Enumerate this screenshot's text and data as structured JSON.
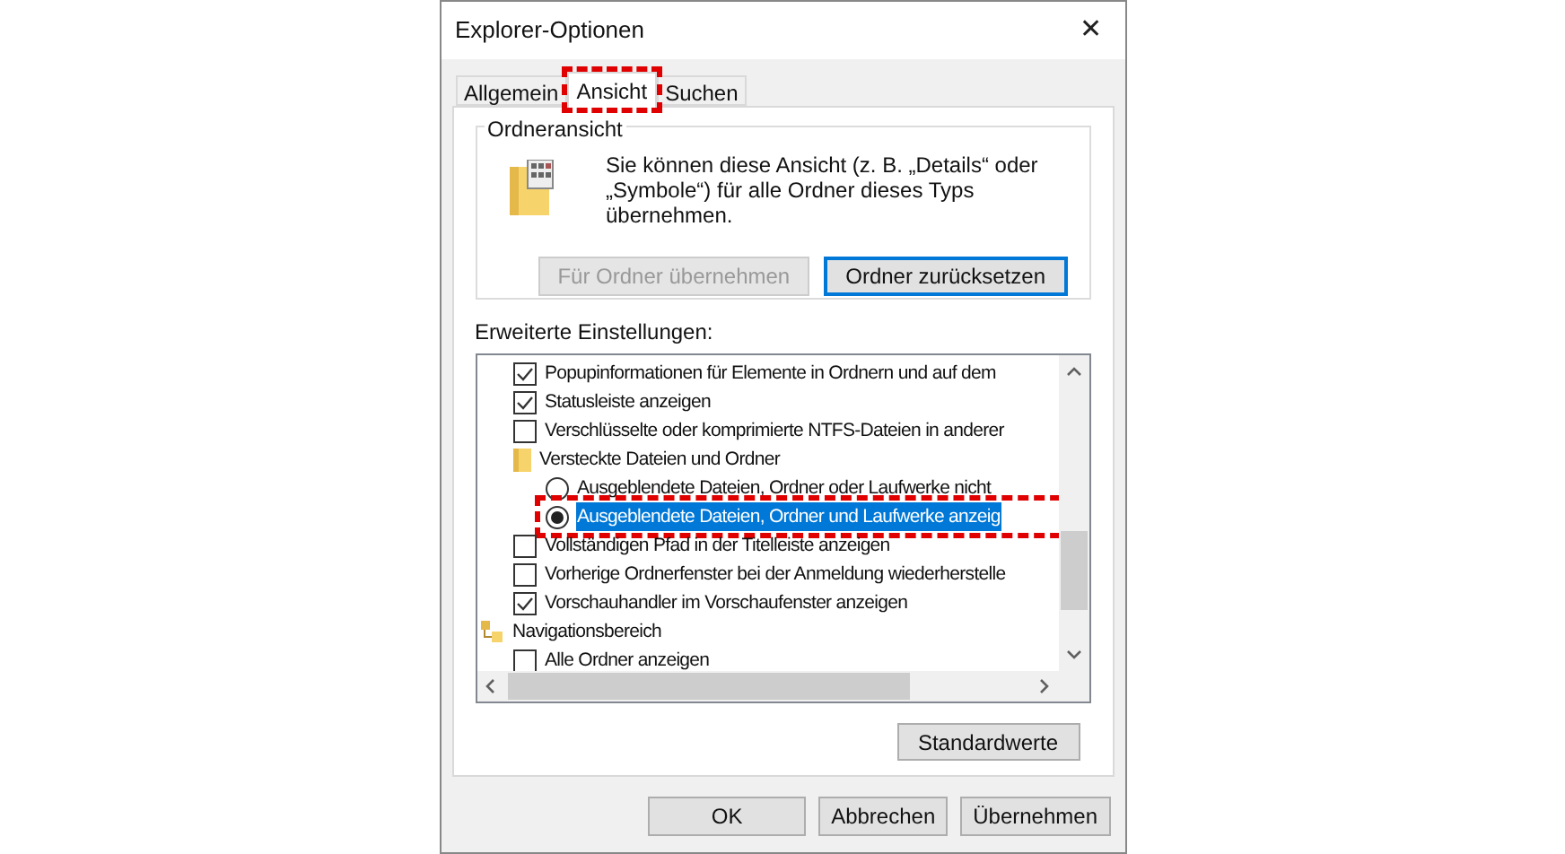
{
  "window": {
    "title": "Explorer-Optionen",
    "close": "✕"
  },
  "tabs": [
    {
      "label": "Allgemein",
      "selected": false,
      "highlight": false
    },
    {
      "label": "Ansicht",
      "selected": true,
      "highlight": true
    },
    {
      "label": "Suchen",
      "selected": false,
      "highlight": false
    }
  ],
  "folder_view": {
    "title": "Ordneransicht",
    "text": "Sie können diese Ansicht (z. B. „Details“ oder „Symbole“) für alle Ordner dieses Typs übernehmen.",
    "buttons": [
      {
        "label": "Für Ordner übernehmen",
        "disabled": true,
        "focused": false
      },
      {
        "label": "Ordner zurücksetzen",
        "disabled": false,
        "focused": true
      }
    ]
  },
  "advanced": {
    "label": "Erweiterte Einstellungen:",
    "items": [
      {
        "kind": "hidden-parent",
        "children": [
          {
            "kind": "checkbox",
            "label": "Popupinformationen für Elemente in Ordnern und auf dem",
            "checked": true,
            "selected": false,
            "highlight": false
          },
          {
            "kind": "checkbox",
            "label": "Statusleiste anzeigen",
            "checked": true,
            "selected": false,
            "highlight": false
          },
          {
            "kind": "checkbox",
            "label": "Verschlüsselte oder komprimierte NTFS-Dateien in anderer",
            "checked": false,
            "selected": false,
            "highlight": false
          },
          {
            "kind": "folder",
            "label": "Versteckte Dateien und Ordner",
            "children": [
              {
                "kind": "radio",
                "label": "Ausgeblendete Dateien, Ordner oder Laufwerke nicht",
                "checked": false,
                "selected": false,
                "highlight": false
              },
              {
                "kind": "radio",
                "label": "Ausgeblendete Dateien, Ordner und Laufwerke anzeig",
                "checked": true,
                "selected": true,
                "highlight": true
              }
            ]
          },
          {
            "kind": "checkbox",
            "label": "Vollständigen Pfad in der Titelleiste anzeigen",
            "checked": false,
            "selected": false,
            "highlight": false
          },
          {
            "kind": "checkbox",
            "label": "Vorherige Ordnerfenster bei der Anmeldung wiederherstelle",
            "checked": false,
            "selected": false,
            "highlight": false
          },
          {
            "kind": "checkbox",
            "label": "Vorschauhandler im Vorschaufenster anzeigen",
            "checked": true,
            "selected": false,
            "highlight": false
          }
        ]
      },
      {
        "kind": "nav",
        "label": "Navigationsbereich",
        "children": [
          {
            "kind": "checkbox",
            "label": "Alle Ordner anzeigen",
            "checked": false,
            "selected": false,
            "highlight": false
          }
        ]
      }
    ],
    "reset_button": "Standardwerte"
  },
  "buttons": [
    "OK",
    "Abbrechen",
    "Übernehmen"
  ]
}
